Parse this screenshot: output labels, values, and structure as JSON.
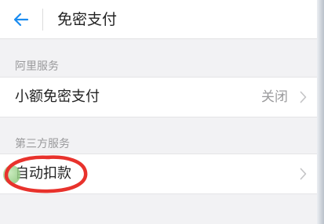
{
  "header": {
    "title": "免密支付",
    "back_icon": "arrow-left-icon",
    "accent_color": "#1a8cf0"
  },
  "sections": [
    {
      "header": "阿里服务",
      "items": [
        {
          "label": "小额免密支付",
          "value": "关闭",
          "icon": "chevron-right-icon"
        }
      ]
    },
    {
      "header": "第三方服务",
      "items": [
        {
          "label": "自动扣款",
          "icon": "chevron-right-icon"
        }
      ]
    }
  ],
  "annotation": {
    "color": "#e8322c",
    "shape": "hand-drawn-ellipse"
  }
}
